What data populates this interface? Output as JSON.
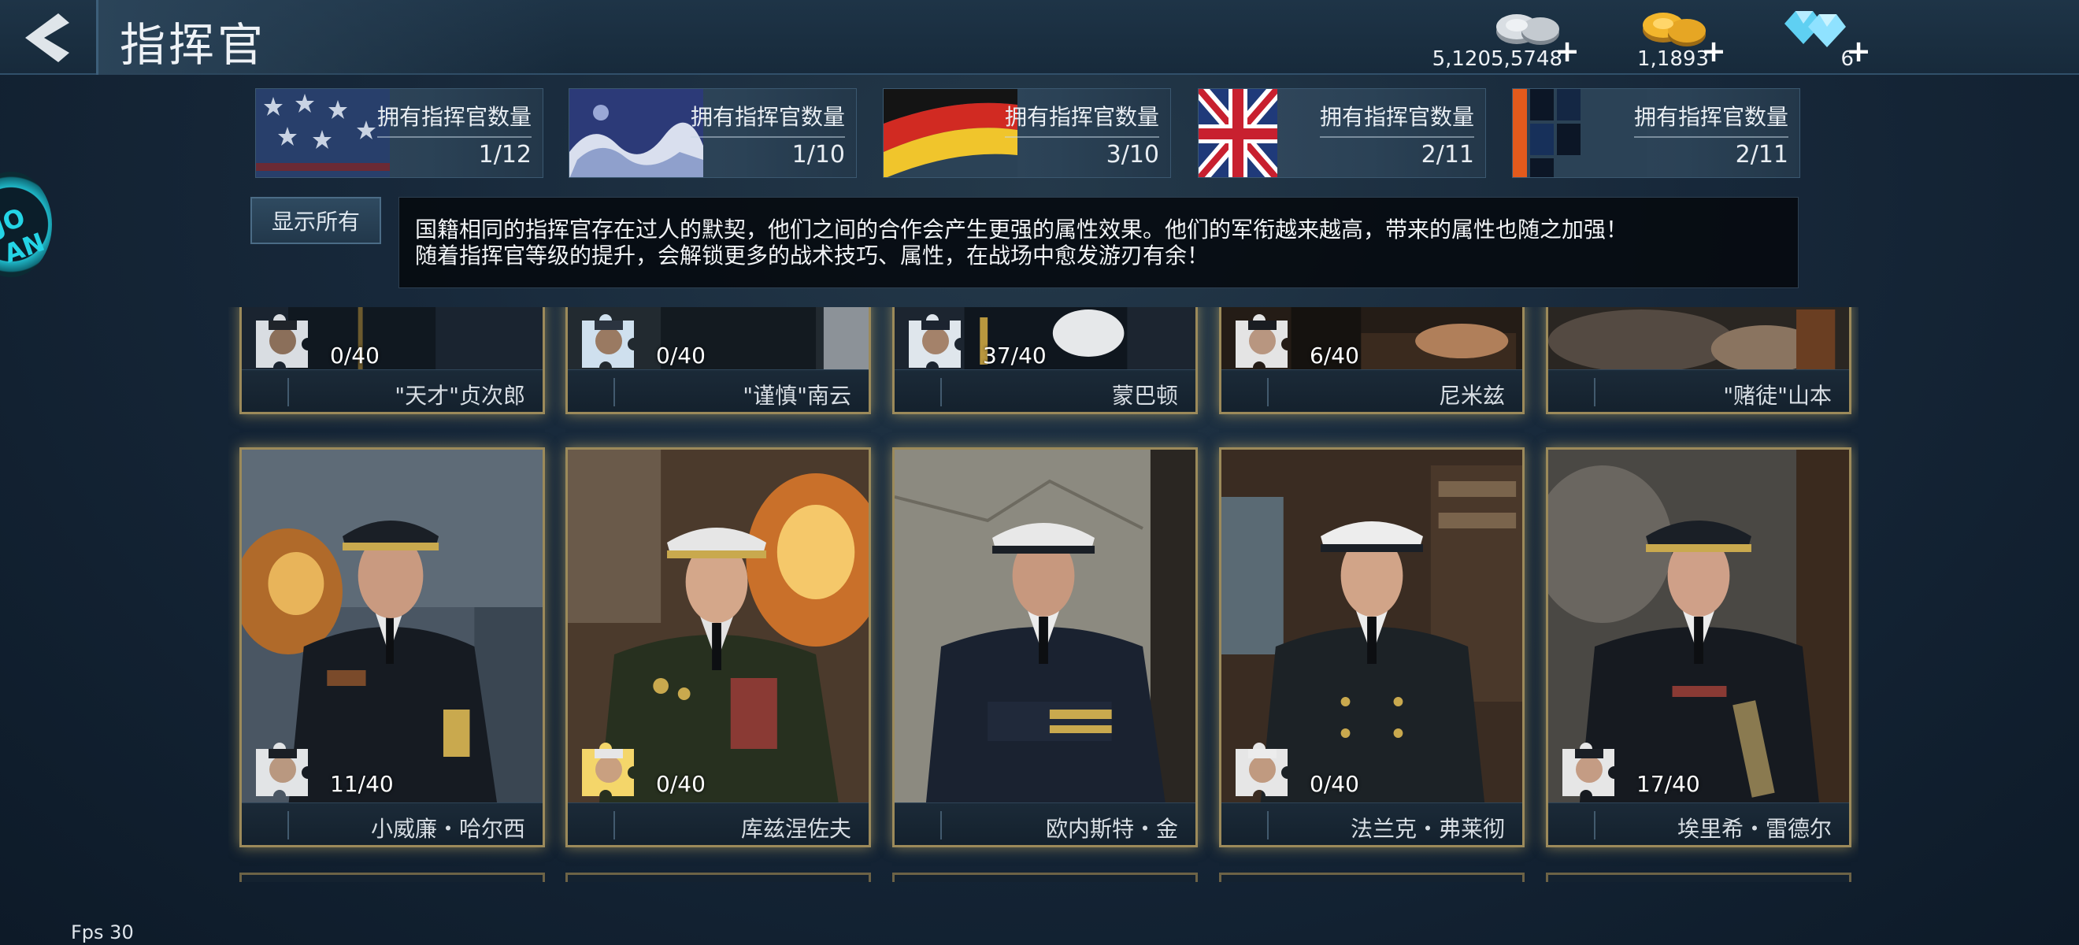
{
  "header": {
    "title": "指挥官",
    "currencies": [
      {
        "name": "silver",
        "amount": "5,1205,5748",
        "plus": "+"
      },
      {
        "name": "gold",
        "amount": "1,1893",
        "plus": "+"
      },
      {
        "name": "diamond",
        "amount": "6",
        "plus": "+"
      }
    ]
  },
  "nation_tabs": [
    {
      "flag": "usa",
      "label": "拥有指挥官数量",
      "count": "1/12"
    },
    {
      "flag": "japan",
      "label": "拥有指挥官数量",
      "count": "1/10"
    },
    {
      "flag": "germany",
      "label": "拥有指挥官数量",
      "count": "3/10"
    },
    {
      "flag": "uk",
      "label": "拥有指挥官数量",
      "count": "2/11"
    },
    {
      "flag": "soviet",
      "label": "拥有指挥官数量",
      "count": "2/11"
    }
  ],
  "show_all_label": "显示所有",
  "info": {
    "line1": "国籍相同的指挥官存在过人的默契，他们之间的合作会产生更强的属性效果。他们的军衔越来越高，带来的属性也随之加强！",
    "line2": "随着指挥官等级的提升，会解锁更多的战术技巧、属性，在战场中愈发游刃有余！"
  },
  "commanders_row1": [
    {
      "name": "\"天才\"贞次郎",
      "progress": "0/40"
    },
    {
      "name": "\"谨慎\"南云",
      "progress": "0/40"
    },
    {
      "name": "蒙巴顿",
      "progress": "37/40"
    },
    {
      "name": "尼米兹",
      "progress": "6/40"
    },
    {
      "name": "\"赌徒\"山本",
      "progress": ""
    }
  ],
  "commanders_row2": [
    {
      "name": "小威廉・哈尔西",
      "progress": "11/40"
    },
    {
      "name": "库兹涅佐夫",
      "progress": "0/40"
    },
    {
      "name": "欧内斯特・金",
      "progress": ""
    },
    {
      "name": "法兰克・弗莱彻",
      "progress": "0/40"
    },
    {
      "name": "埃里希・雷德尔",
      "progress": "17/40"
    }
  ],
  "side_widget_text": "JO AN",
  "fps_label": "Fps 30"
}
